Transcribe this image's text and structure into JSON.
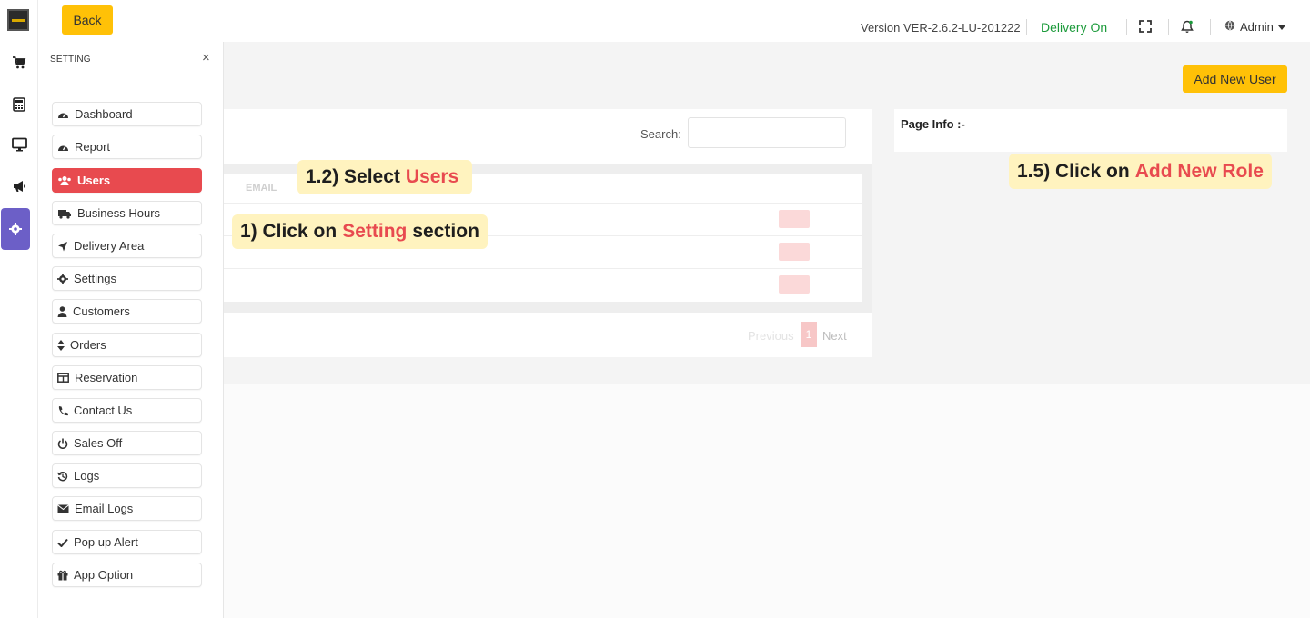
{
  "topbar": {
    "back_label": "Back",
    "version": "Version VER-2.6.2-LU-201222",
    "delivery_status": "Delivery On",
    "admin_label": "Admin",
    "icons": [
      "fullscreen-icon",
      "bell-icon",
      "globe-icon",
      "chevron-down-icon"
    ]
  },
  "rail": {
    "items": [
      "cart-icon",
      "calculator-icon",
      "monitor-icon",
      "megaphone-icon",
      "gear-icon"
    ],
    "active": "gear-icon"
  },
  "panel": {
    "heading": "SETTING",
    "close": "×",
    "items": [
      {
        "label": "Dashboard",
        "icon": "dashboard-icon"
      },
      {
        "label": "Report",
        "icon": "dashboard-icon"
      },
      {
        "label": "Users",
        "icon": "users-icon",
        "active": true
      },
      {
        "label": "Business Hours",
        "icon": "truck-icon"
      },
      {
        "label": "Delivery Area",
        "icon": "location-arrow-icon"
      },
      {
        "label": "Settings",
        "icon": "gear-icon"
      },
      {
        "label": "Customers",
        "icon": "user-icon"
      },
      {
        "label": "Orders",
        "icon": "sort-icon"
      },
      {
        "label": "Reservation",
        "icon": "table-icon"
      },
      {
        "label": "Contact Us",
        "icon": "phone-icon"
      },
      {
        "label": "Sales Off",
        "icon": "power-icon"
      },
      {
        "label": "Logs",
        "icon": "history-icon"
      },
      {
        "label": "Email Logs",
        "icon": "envelope-icon"
      },
      {
        "label": "Pop up Alert",
        "icon": "check-icon"
      },
      {
        "label": "App Option",
        "icon": "gift-icon"
      }
    ]
  },
  "main": {
    "add_user_label": "Add New User",
    "search_label": "Search:",
    "email_header": "EMAIL",
    "pager": {
      "previous": "Previous",
      "current": "1",
      "next": "Next"
    },
    "page_info": "Page Info :-"
  },
  "callouts": [
    {
      "prefix": "1.2)  Select",
      "highlight": "Users",
      "suffix": ""
    },
    {
      "prefix": "1)  Click on",
      "highlight": "Setting",
      "suffix": "section"
    },
    {
      "prefix": "1.5)  Click on",
      "highlight": "Add New Role",
      "suffix": ""
    }
  ],
  "colors": {
    "accent_yellow": "#ffc107",
    "active_red": "#e84a4f",
    "rail_active": "#6c5fc7",
    "delivery_green": "#1b9a3a",
    "callout_bg": "#fff3bf"
  }
}
